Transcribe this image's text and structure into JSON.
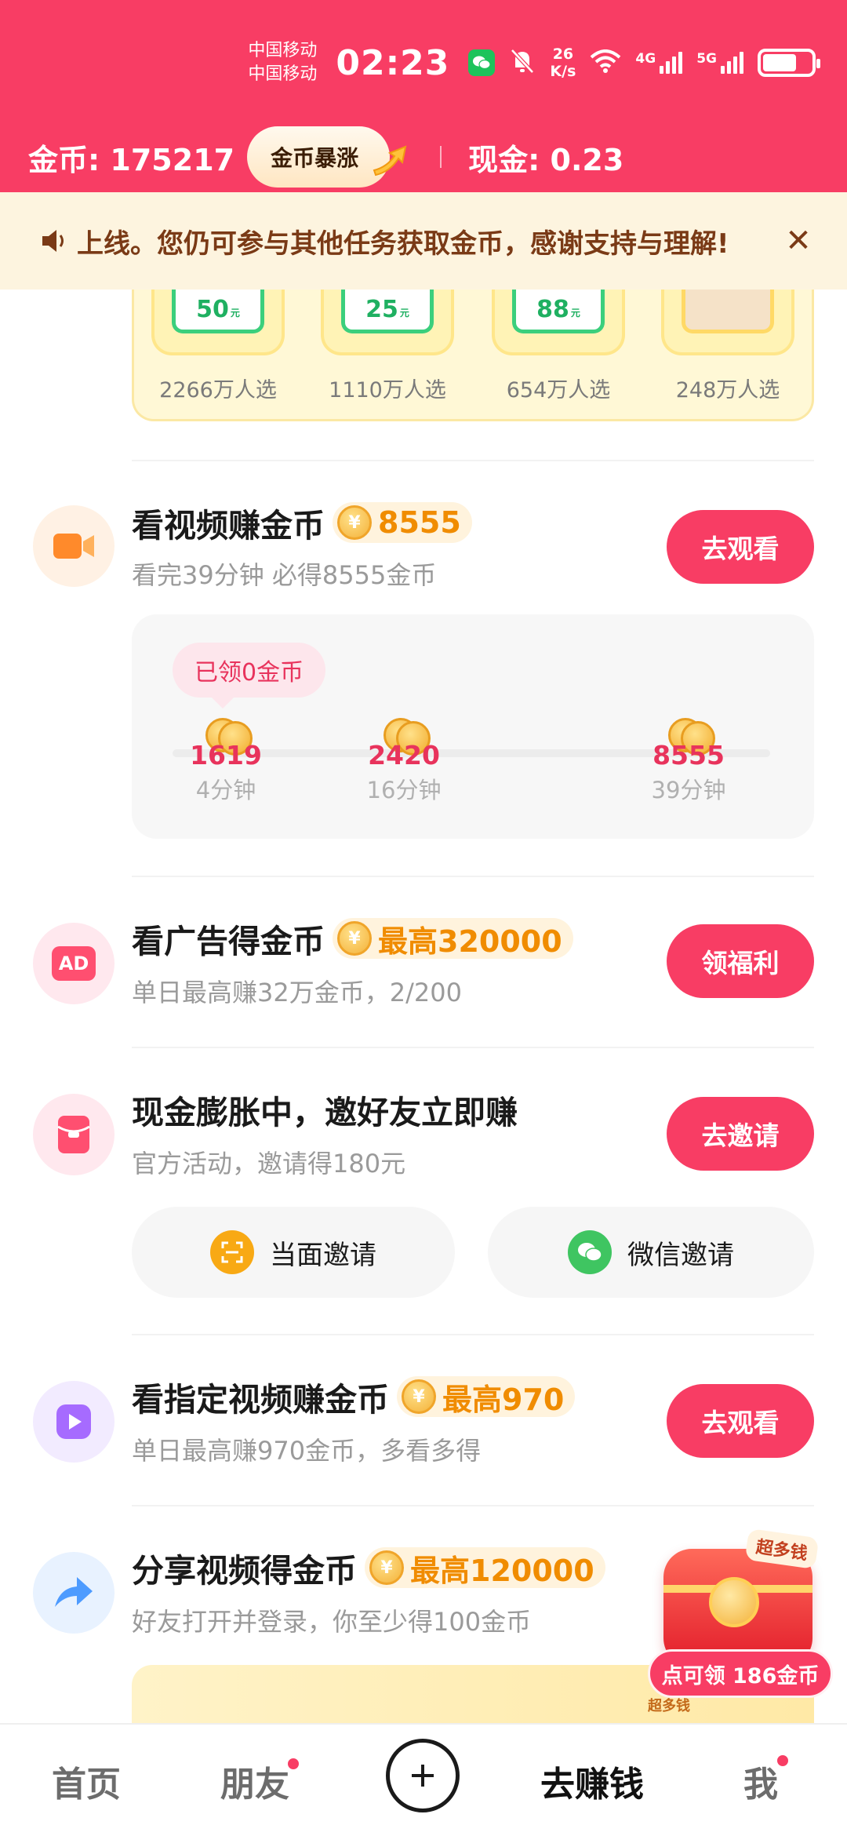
{
  "status_bar": {
    "carrier1": "中国移动",
    "carrier2": "中国移动",
    "time": "02:23",
    "net_speed_value": "26",
    "net_speed_unit": "K/s",
    "sim1_label": "4G",
    "sim2_label": "5G",
    "icons": [
      "wechat-notification-icon",
      "mute-bell-icon",
      "wifi-icon",
      "signal-4g-icon",
      "signal-5g-icon",
      "battery-icon"
    ]
  },
  "header": {
    "coins_label": "金币: 175217",
    "boost_label": "金币暴涨",
    "cash_label": "现金: 0.23"
  },
  "notice": {
    "text": "上线。您仍可参与其他任务获取金币，感谢支持与理解!",
    "close_symbol": "✕"
  },
  "products": [
    {
      "price": "50",
      "unit": "元",
      "picks": "2266万人选"
    },
    {
      "price": "25",
      "unit": "元",
      "picks": "1110万人选"
    },
    {
      "price": "88",
      "unit": "元",
      "picks": "654万人选"
    },
    {
      "price": "",
      "unit": "",
      "picks": "248万人选"
    }
  ],
  "tasks": {
    "video": {
      "title": "看视频赚金币",
      "coin_value": "8555",
      "sub": "看完39分钟 必得8555金币",
      "button": "去观看",
      "claimed": "已领0金币",
      "milestones": [
        {
          "value": "1619",
          "time": "4分钟"
        },
        {
          "value": "2420",
          "time": "16分钟"
        },
        {
          "value": "8555",
          "time": "39分钟"
        }
      ]
    },
    "ads": {
      "title": "看广告得金币",
      "coin_value": "最高320000",
      "sub": "单日最高赚32万金币，2/200",
      "button": "领福利",
      "icon_text": "AD"
    },
    "invite": {
      "title": "现金膨胀中，邀好友立即赚",
      "sub": "官方活动，邀请得180元",
      "button": "去邀请",
      "face_invite": "当面邀请",
      "wechat_invite": "微信邀请"
    },
    "specified_video": {
      "title": "看指定视频赚金币",
      "coin_value": "最高970",
      "sub": "单日最高赚970金币，多看多得",
      "button": "去观看"
    },
    "share": {
      "title": "分享视频得金币",
      "coin_value": "最高120000",
      "sub": "好友打开并登录，你至少得100金币"
    }
  },
  "floating_reward": {
    "badge": "超多钱",
    "label": "点可领 186金币",
    "promo_mark": "超多钱"
  },
  "bottom_nav": {
    "home": "首页",
    "friends": "朋友",
    "earn": "去赚钱",
    "me": "我"
  },
  "colors": {
    "brand": "#f83d64",
    "coin_orange": "#f08c00",
    "notice_bg": "#fdf4df"
  }
}
